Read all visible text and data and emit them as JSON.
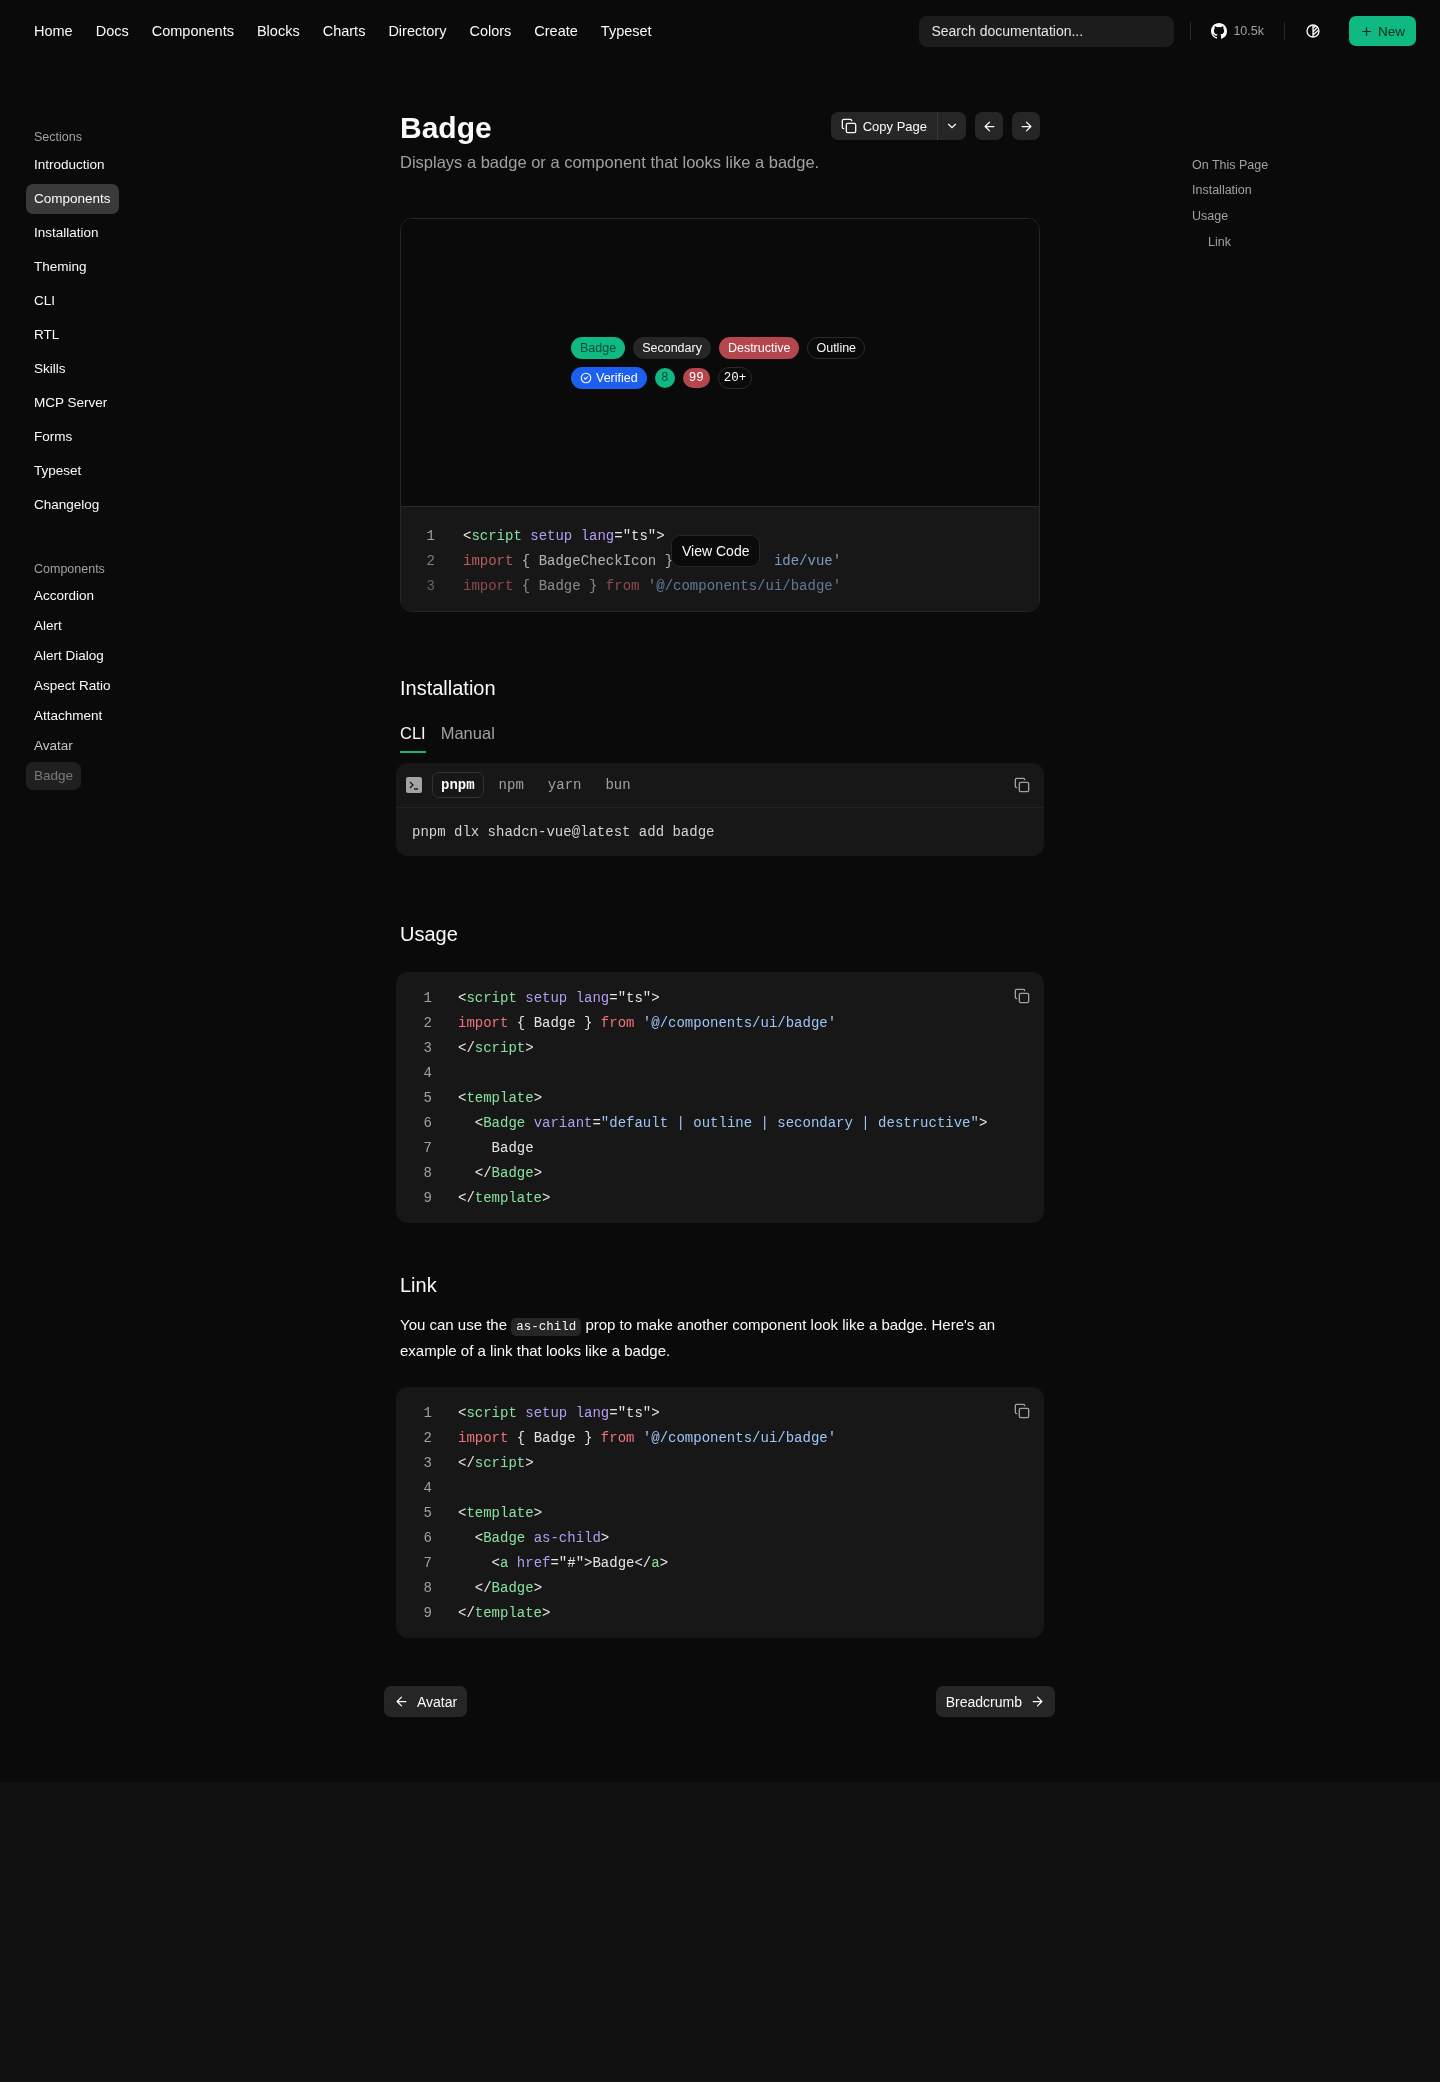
{
  "nav": {
    "links": [
      "Home",
      "Docs",
      "Components",
      "Blocks",
      "Charts",
      "Directory",
      "Colors",
      "Create",
      "Typeset"
    ],
    "search": {
      "placeholder": "Search documentation..."
    },
    "github_stars": "10.5k",
    "new_button": "New"
  },
  "sidebar": {
    "groups": [
      {
        "title": "Sections",
        "items": [
          {
            "label": "Introduction",
            "selected": false
          },
          {
            "label": "Components",
            "selected": true
          },
          {
            "label": "Installation",
            "selected": false
          },
          {
            "label": "Theming",
            "selected": false
          },
          {
            "label": "CLI",
            "selected": false
          },
          {
            "label": "RTL",
            "selected": false
          },
          {
            "label": "Skills",
            "selected": false
          },
          {
            "label": "MCP Server",
            "selected": false
          },
          {
            "label": "Forms",
            "selected": false
          },
          {
            "label": "Typeset",
            "selected": false
          },
          {
            "label": "Changelog",
            "selected": false
          }
        ]
      },
      {
        "title": "Components",
        "items": [
          {
            "label": "Accordion",
            "selected": false
          },
          {
            "label": "Alert",
            "selected": false
          },
          {
            "label": "Alert Dialog",
            "selected": false
          },
          {
            "label": "Aspect Ratio",
            "selected": false
          },
          {
            "label": "Attachment",
            "selected": false
          },
          {
            "label": "Avatar",
            "selected": false
          },
          {
            "label": "Badge",
            "selected": true
          }
        ]
      }
    ]
  },
  "page": {
    "title": "Badge",
    "description": "Displays a badge or a component that looks like a badge.",
    "copy_button": "Copy Page"
  },
  "preview": {
    "badge_rows": [
      [
        {
          "text": "Badge",
          "kind": "default"
        },
        {
          "text": "Secondary",
          "kind": "secondary"
        },
        {
          "text": "Destructive",
          "kind": "destructive"
        },
        {
          "text": "Outline",
          "kind": "outline"
        }
      ],
      [
        {
          "text": "Verified",
          "kind": "verified"
        },
        {
          "text": "8",
          "kind": "count-default"
        },
        {
          "text": "99",
          "kind": "count-destructive"
        },
        {
          "text": "20+",
          "kind": "count-outline"
        }
      ]
    ],
    "code_lines": [
      {
        "number": "1",
        "tokens": [
          {
            "text": "<",
            "kind": "punct"
          },
          {
            "text": "script",
            "kind": "tag"
          },
          {
            "text": " setup",
            "kind": "attr"
          },
          {
            "text": " lang",
            "kind": "attr"
          },
          {
            "text": "=\"ts\">",
            "kind": "punct"
          }
        ]
      },
      {
        "number": "2",
        "tokens": [
          {
            "text": "import",
            "kind": "keyword"
          },
          {
            "text": " { BadgeCheckIcon }",
            "kind": "plain"
          },
          {
            "text": "ide/vue'",
            "kind": "string-after-gap"
          }
        ]
      },
      {
        "number": "3",
        "tokens": [
          {
            "text": "import",
            "kind": "keyword"
          },
          {
            "text": " { Badge } ",
            "kind": "plain"
          },
          {
            "text": "from",
            "kind": "keyword"
          },
          {
            "text": " '@/components/ui/badge'",
            "kind": "string"
          }
        ]
      }
    ],
    "view_code_button": "View Code"
  },
  "installation": {
    "title": "Installation",
    "tabs": [
      {
        "label": "CLI",
        "selected": true
      },
      {
        "label": "Manual",
        "selected": false
      }
    ],
    "package_managers": [
      {
        "label": "pnpm",
        "selected": true
      },
      {
        "label": "npm",
        "selected": false
      },
      {
        "label": "yarn",
        "selected": false
      },
      {
        "label": "bun",
        "selected": false
      }
    ],
    "command": "pnpm dlx shadcn-vue@latest add badge"
  },
  "usage": {
    "title": "Usage",
    "code_lines": [
      {
        "number": "1",
        "tokens": [
          {
            "text": "<",
            "kind": "punct"
          },
          {
            "text": "script",
            "kind": "tag"
          },
          {
            "text": " setup",
            "kind": "attr"
          },
          {
            "text": " lang",
            "kind": "attr"
          },
          {
            "text": "=\"ts\">",
            "kind": "punct"
          }
        ]
      },
      {
        "number": "2",
        "tokens": [
          {
            "text": "import",
            "kind": "keyword"
          },
          {
            "text": " { Badge } ",
            "kind": "plain"
          },
          {
            "text": "from",
            "kind": "keyword"
          },
          {
            "text": " '@/components/ui/badge'",
            "kind": "string"
          }
        ]
      },
      {
        "number": "3",
        "tokens": [
          {
            "text": "</",
            "kind": "punct"
          },
          {
            "text": "script",
            "kind": "tag"
          },
          {
            "text": ">",
            "kind": "punct"
          }
        ]
      },
      {
        "number": "4"
      },
      {
        "number": "5",
        "tokens": [
          {
            "text": "<",
            "kind": "punct"
          },
          {
            "text": "template",
            "kind": "tag"
          },
          {
            "text": ">",
            "kind": "punct"
          }
        ]
      },
      {
        "number": "6",
        "tokens": [
          {
            "text": "  <",
            "kind": "punct"
          },
          {
            "text": "Badge",
            "kind": "tag"
          },
          {
            "text": " variant",
            "kind": "attr"
          },
          {
            "text": "=",
            "kind": "punct"
          },
          {
            "text": "\"default | outline | secondary | destructive\"",
            "kind": "string"
          },
          {
            "text": ">",
            "kind": "punct"
          }
        ]
      },
      {
        "number": "7",
        "tokens": [
          {
            "text": "    Badge",
            "kind": "plain"
          }
        ]
      },
      {
        "number": "8",
        "tokens": [
          {
            "text": "  </",
            "kind": "punct"
          },
          {
            "text": "Badge",
            "kind": "tag"
          },
          {
            "text": ">",
            "kind": "punct"
          }
        ]
      },
      {
        "number": "9",
        "tokens": [
          {
            "text": "</",
            "kind": "punct"
          },
          {
            "text": "template",
            "kind": "tag"
          },
          {
            "text": ">",
            "kind": "punct"
          }
        ]
      }
    ]
  },
  "link": {
    "title": "Link",
    "paragraph": {
      "before": "You can use the",
      "code": "as-child",
      "after": "prop to make another component look like a badge. Here's an example of a link that looks like a badge."
    },
    "code_lines": [
      {
        "number": "1",
        "tokens": [
          {
            "text": "<",
            "kind": "punct"
          },
          {
            "text": "script",
            "kind": "tag"
          },
          {
            "text": " setup",
            "kind": "attr"
          },
          {
            "text": " lang",
            "kind": "attr"
          },
          {
            "text": "=\"ts\">",
            "kind": "punct"
          }
        ]
      },
      {
        "number": "2",
        "tokens": [
          {
            "text": "import",
            "kind": "keyword"
          },
          {
            "text": " { Badge } ",
            "kind": "plain"
          },
          {
            "text": "from",
            "kind": "keyword"
          },
          {
            "text": " '@/components/ui/badge'",
            "kind": "string"
          }
        ]
      },
      {
        "number": "3",
        "tokens": [
          {
            "text": "</",
            "kind": "punct"
          },
          {
            "text": "script",
            "kind": "tag"
          },
          {
            "text": ">",
            "kind": "punct"
          }
        ]
      },
      {
        "number": "4"
      },
      {
        "number": "5",
        "tokens": [
          {
            "text": "<",
            "kind": "punct"
          },
          {
            "text": "template",
            "kind": "tag"
          },
          {
            "text": ">",
            "kind": "punct"
          }
        ]
      },
      {
        "number": "6",
        "tokens": [
          {
            "text": "  <",
            "kind": "punct"
          },
          {
            "text": "Badge",
            "kind": "tag"
          },
          {
            "text": " as-child",
            "kind": "attr"
          },
          {
            "text": ">",
            "kind": "punct"
          }
        ]
      },
      {
        "number": "7",
        "tokens": [
          {
            "text": "    <",
            "kind": "punct"
          },
          {
            "text": "a",
            "kind": "tag"
          },
          {
            "text": " href",
            "kind": "attr"
          },
          {
            "text": "=\"#\">Badge</",
            "kind": "punct"
          },
          {
            "text": "a",
            "kind": "tag"
          },
          {
            "text": ">",
            "kind": "punct"
          }
        ]
      },
      {
        "number": "8",
        "tokens": [
          {
            "text": "  </",
            "kind": "punct"
          },
          {
            "text": "Badge",
            "kind": "tag"
          },
          {
            "text": ">",
            "kind": "punct"
          }
        ]
      },
      {
        "number": "9",
        "tokens": [
          {
            "text": "</",
            "kind": "punct"
          },
          {
            "text": "template",
            "kind": "tag"
          },
          {
            "text": ">",
            "kind": "punct"
          }
        ]
      }
    ]
  },
  "pager": {
    "previous": "Avatar",
    "next": "Breadcrumb"
  },
  "toc": {
    "title": "On This Page",
    "items": [
      {
        "label": "Installation"
      },
      {
        "label": "Usage",
        "children": [
          {
            "label": "Link"
          }
        ]
      }
    ]
  }
}
